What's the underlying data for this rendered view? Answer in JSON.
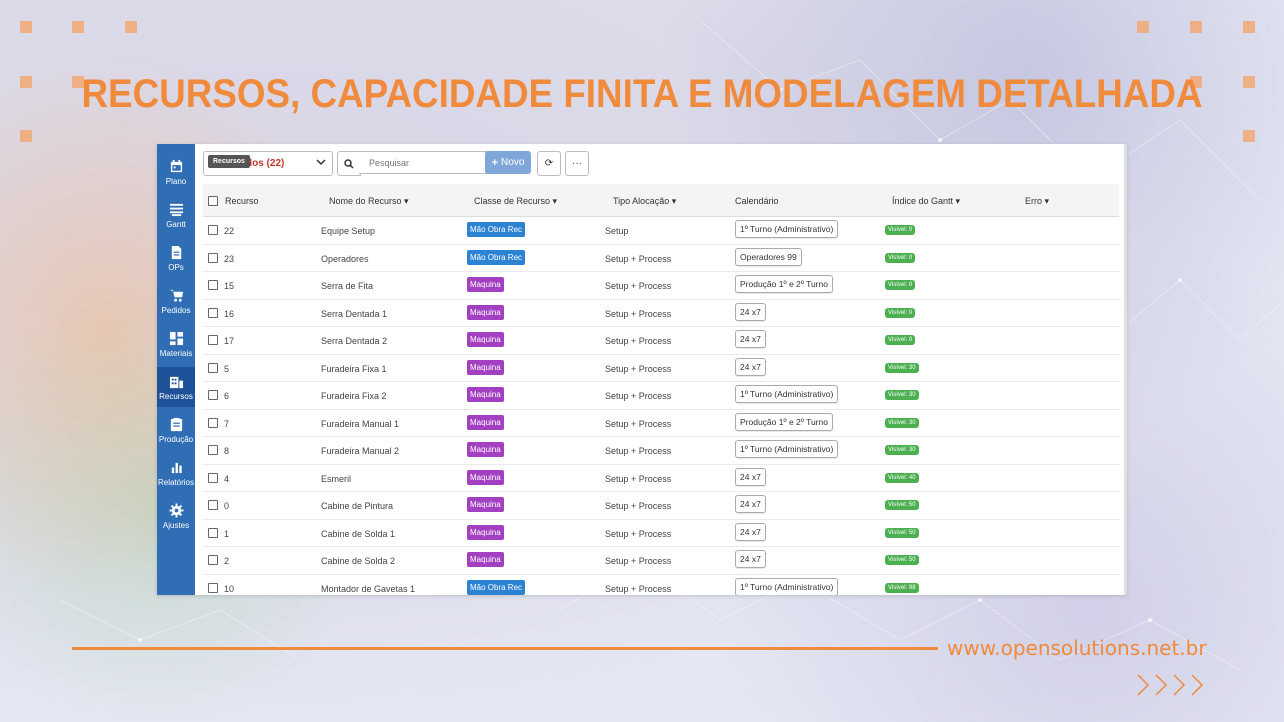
{
  "title": "RECURSOS, CAPACIDADE FINITA E MODELAGEM DETALHADA",
  "footer": {
    "url": "www.opensolutions.net.br"
  },
  "colors": {
    "accent": "#f08a3c",
    "sidebar": "#2f6db5",
    "mao_tag": "#2c82d3",
    "maq_tag": "#a33fc1",
    "gantt_badge": "#4caf50"
  },
  "sidebar": {
    "items": [
      {
        "label": "Plano",
        "icon": "calendar-icon"
      },
      {
        "label": "Gantt",
        "icon": "gantt-icon"
      },
      {
        "label": "OPs",
        "icon": "document-icon"
      },
      {
        "label": "Pedidos",
        "icon": "cart-icon"
      },
      {
        "label": "Materiais",
        "icon": "grid-icon"
      },
      {
        "label": "Recursos",
        "icon": "building-icon"
      },
      {
        "label": "Produção",
        "icon": "clipboard-icon"
      },
      {
        "label": "Relatórios",
        "icon": "bar-chart-icon"
      },
      {
        "label": "Ajustes",
        "icon": "gear-icon"
      }
    ]
  },
  "toolbar": {
    "select_value": "dos (22)",
    "tooltip": "Recursos",
    "search_placeholder": "Pesquisar",
    "new_label": "Novo",
    "refresh_symbol": "⟳",
    "more_symbol": "···"
  },
  "table": {
    "headers": {
      "recurso": "Recurso",
      "nome": "Nome do Recurso ▾",
      "classe": "Classe de Recurso ▾",
      "tipo": "Tipo Alocação ▾",
      "calendario": "Calendário",
      "indice": "Índice do Gantt ▾",
      "erro": "Erro ▾"
    },
    "rows": [
      {
        "id": "22",
        "nome": "Equipe Setup",
        "classe": "Mão Obra Rec",
        "kind": "mao",
        "tipo": "Setup",
        "cal": "1º Turno (Administrativo)",
        "gantt": "Visível: 0"
      },
      {
        "id": "23",
        "nome": "Operadores",
        "classe": "Mão Obra Rec",
        "kind": "mao",
        "tipo": "Setup + Process",
        "cal": "Operadores 99",
        "gantt": "Visível: 0"
      },
      {
        "id": "15",
        "nome": "Serra de Fita",
        "classe": "Maquina",
        "kind": "maq",
        "tipo": "Setup + Process",
        "cal": "Produção 1º e 2º Turno",
        "gantt": "Visível: 0"
      },
      {
        "id": "16",
        "nome": "Serra Dentada 1",
        "classe": "Maquina",
        "kind": "maq",
        "tipo": "Setup + Process",
        "cal": "24 x7",
        "gantt": "Visível: 0"
      },
      {
        "id": "17",
        "nome": "Serra Dentada 2",
        "classe": "Maquina",
        "kind": "maq",
        "tipo": "Setup + Process",
        "cal": "24 x7",
        "gantt": "Visível: 0"
      },
      {
        "id": "5",
        "nome": "Furadeira Fixa 1",
        "classe": "Maquina",
        "kind": "maq",
        "tipo": "Setup + Process",
        "cal": "24 x7",
        "gantt": "Visível: 30"
      },
      {
        "id": "6",
        "nome": "Furadeira Fixa 2",
        "classe": "Maquina",
        "kind": "maq",
        "tipo": "Setup + Process",
        "cal": "1º Turno (Administrativo)",
        "gantt": "Visível: 30"
      },
      {
        "id": "7",
        "nome": "Furadeira Manual 1",
        "classe": "Maquina",
        "kind": "maq",
        "tipo": "Setup + Process",
        "cal": "Produção 1º e 2º Turno",
        "gantt": "Visível: 30"
      },
      {
        "id": "8",
        "nome": "Furadeira Manual 2",
        "classe": "Maquina",
        "kind": "maq",
        "tipo": "Setup + Process",
        "cal": "1º Turno (Administrativo)",
        "gantt": "Visível: 30"
      },
      {
        "id": "4",
        "nome": "Esmeril",
        "classe": "Maquina",
        "kind": "maq",
        "tipo": "Setup + Process",
        "cal": "24 x7",
        "gantt": "Visível: 40"
      },
      {
        "id": "0",
        "nome": "Cabine de Pintura",
        "classe": "Maquina",
        "kind": "maq",
        "tipo": "Setup + Process",
        "cal": "24 x7",
        "gantt": "Visível: 50"
      },
      {
        "id": "1",
        "nome": "Cabine de Solda 1",
        "classe": "Maquina",
        "kind": "maq",
        "tipo": "Setup + Process",
        "cal": "24 x7",
        "gantt": "Visível: 50"
      },
      {
        "id": "2",
        "nome": "Cabine de Solda 2",
        "classe": "Maquina",
        "kind": "maq",
        "tipo": "Setup + Process",
        "cal": "24 x7",
        "gantt": "Visível: 50"
      },
      {
        "id": "10",
        "nome": "Montador de Gavetas 1",
        "classe": "Mão Obra Rec",
        "kind": "mao",
        "tipo": "Setup + Process",
        "cal": "1º Turno (Administrativo)",
        "gantt": "Visível: 98"
      }
    ]
  }
}
